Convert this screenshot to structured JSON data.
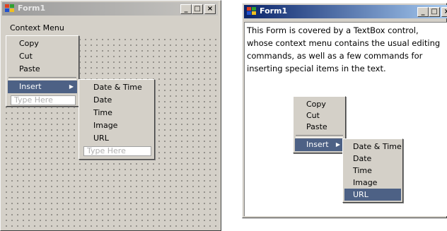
{
  "left_form": {
    "title": "Form1",
    "caption_buttons": [
      "_",
      "□",
      "×"
    ],
    "menustrip_label": "Context Menu",
    "menu_items": [
      "Copy",
      "Cut",
      "Paste"
    ],
    "insert_label": "Insert",
    "type_here": "Type Here",
    "submenu_items": [
      "Date & Time",
      "Date",
      "Time",
      "Image",
      "URL"
    ]
  },
  "right_form": {
    "title": "Form1",
    "caption_buttons": [
      "_",
      "□",
      "×"
    ],
    "textbox_lines": [
      "This Form is covered  by a TextBox control,",
      "whose context menu contains the usual editing",
      "commands, as well as a few commands for",
      "inserting special items in the text."
    ],
    "menu_items": [
      "Copy",
      "Cut",
      "Paste"
    ],
    "insert_label": "Insert",
    "submenu_items": [
      "Date & Time",
      "Date",
      "Time",
      "Image",
      "URL"
    ],
    "selected_submenu_item": "URL"
  },
  "colors": {
    "face": "#d4d0c8",
    "active_title": "#0a246a",
    "inactive_title": "#9b9b9b",
    "highlight": "#4d6185"
  },
  "icons": {
    "app_icon": "windows-form-icon",
    "submenu_arrow": "triangle-right"
  }
}
